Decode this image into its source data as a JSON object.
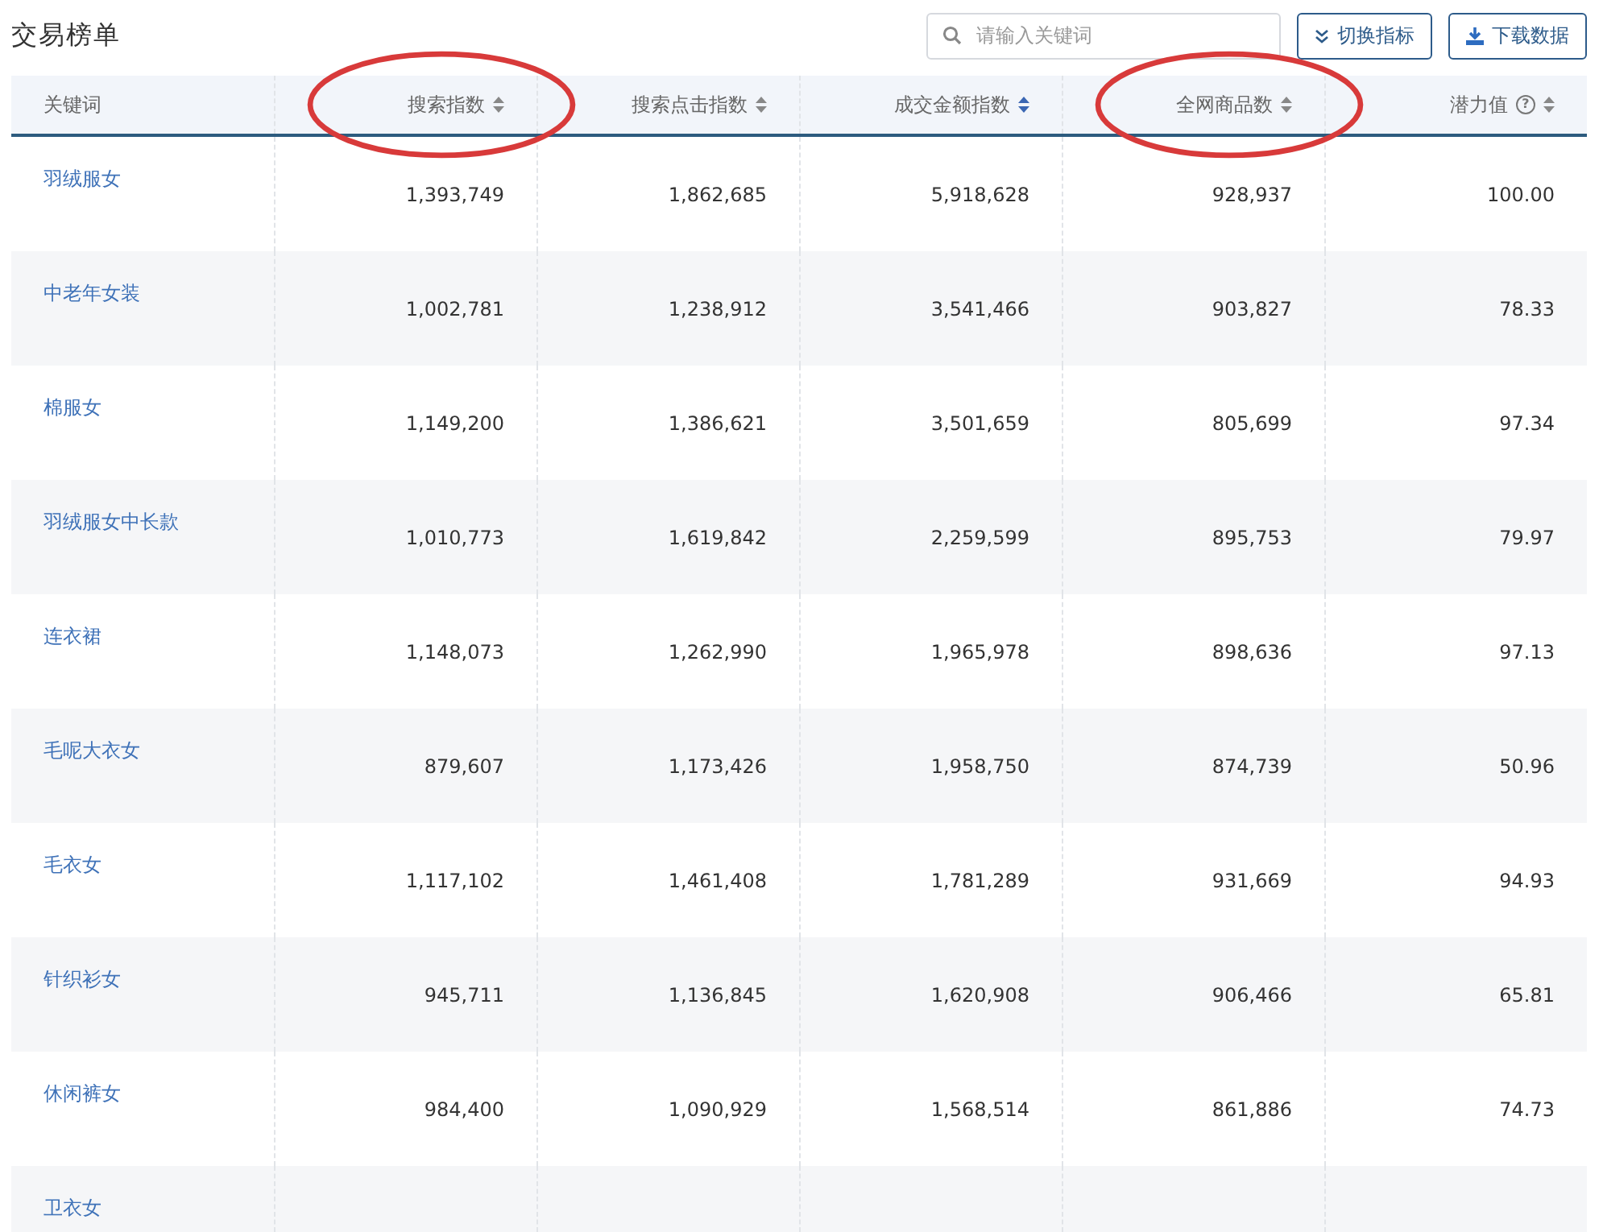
{
  "title": "交易榜单",
  "search": {
    "placeholder": "请输入关键词"
  },
  "buttons": [
    {
      "kind": "switch",
      "label": "切换指标"
    },
    {
      "kind": "download",
      "label": "下载数据"
    }
  ],
  "table": {
    "columns": [
      {
        "label": "关键词",
        "sortable": false,
        "circled": false
      },
      {
        "label": "搜索指数",
        "sortable": true,
        "sorted": false,
        "circled": true
      },
      {
        "label": "搜索点击指数",
        "sortable": true,
        "sorted": false,
        "circled": false
      },
      {
        "label": "成交金额指数",
        "sortable": true,
        "sorted": true,
        "circled": false
      },
      {
        "label": "全网商品数",
        "sortable": true,
        "sorted": false,
        "circled": true
      },
      {
        "label": "潜力值",
        "sortable": true,
        "help": "?",
        "sorted": false,
        "circled": false
      }
    ],
    "rows": [
      [
        "羽绒服女",
        "1,393,749",
        "1,862,685",
        "5,918,628",
        "928,937",
        "100.00"
      ],
      [
        "中老年女装",
        "1,002,781",
        "1,238,912",
        "3,541,466",
        "903,827",
        "78.33"
      ],
      [
        "棉服女",
        "1,149,200",
        "1,386,621",
        "3,501,659",
        "805,699",
        "97.34"
      ],
      [
        "羽绒服女中长款",
        "1,010,773",
        "1,619,842",
        "2,259,599",
        "895,753",
        "79.97"
      ],
      [
        "连衣裙",
        "1,148,073",
        "1,262,990",
        "1,965,978",
        "898,636",
        "97.13"
      ],
      [
        "毛呢大衣女",
        "879,607",
        "1,173,426",
        "1,958,750",
        "874,739",
        "50.96"
      ],
      [
        "毛衣女",
        "1,117,102",
        "1,461,408",
        "1,781,289",
        "931,669",
        "94.93"
      ],
      [
        "针织衫女",
        "945,711",
        "1,136,845",
        "1,620,908",
        "906,466",
        "65.81"
      ],
      [
        "休闲裤女",
        "984,400",
        "1,090,929",
        "1,568,514",
        "861,886",
        "74.73"
      ],
      [
        "卫衣女"
      ]
    ]
  }
}
